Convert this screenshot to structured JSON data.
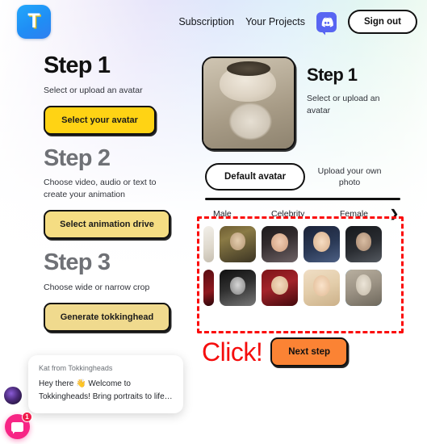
{
  "header": {
    "logo_letter": "T",
    "nav_links": [
      {
        "label": "Subscription"
      },
      {
        "label": "Your Projects"
      }
    ],
    "discord_icon": "discord-icon",
    "signout_label": "Sign out"
  },
  "left_steps": [
    {
      "title": "Step 1",
      "desc": "Select or upload an avatar",
      "button": "Select your avatar"
    },
    {
      "title": "Step 2",
      "desc": "Choose video, audio or text to create your animation",
      "button": "Select animation drive"
    },
    {
      "title": "Step 3",
      "desc": "Choose wide or narrow crop",
      "button": "Generate tokkinghead"
    }
  ],
  "preview": {
    "title": "Step 1",
    "desc": "Select or upload an avatar",
    "image_alt": "statue-avatar-thumbnail"
  },
  "tabs": {
    "default_avatar": "Default avatar",
    "upload_photo": "Upload your own photo"
  },
  "categories": [
    {
      "label": "Male"
    },
    {
      "label": "Celebrity"
    },
    {
      "label": "Female"
    }
  ],
  "category_chevron": "chevron-right-icon",
  "avatar_grid": {
    "row1": [
      {
        "name": "partial-avatar-left",
        "face": "f-light",
        "partial": true,
        "selected": false
      },
      {
        "name": "avatar-caesar-portrait",
        "face": "f-caesar",
        "partial": false,
        "selected": false
      },
      {
        "name": "avatar-dark-hair-woman",
        "face": "f-selena",
        "partial": false,
        "selected": false
      },
      {
        "name": "avatar-blonde-bob-woman",
        "face": "f-taylor1",
        "partial": false,
        "selected": false
      },
      {
        "name": "avatar-bald-man",
        "face": "f-man1",
        "partial": false,
        "selected": false
      }
    ],
    "row2": [
      {
        "name": "partial-avatar-left-2",
        "face": "f-red",
        "partial": true,
        "selected": false
      },
      {
        "name": "avatar-black-and-white-woman",
        "face": "f-bw",
        "partial": false,
        "selected": false
      },
      {
        "name": "avatar-blonde-woman-red-bg",
        "face": "f-taylor2",
        "partial": false,
        "selected": false
      },
      {
        "name": "avatar-blonde-man",
        "face": "f-justin",
        "partial": false,
        "selected": false
      },
      {
        "name": "avatar-statue-selected",
        "face": "f-statue",
        "partial": false,
        "selected": true
      }
    ]
  },
  "annotation": {
    "click_label": "Click!",
    "highlight_color": "#fb0b0b"
  },
  "next_step_button": "Next step",
  "chat": {
    "sender": "Kat from Tokkingheads",
    "message": "Hey there 👋 Welcome to Tokkingheads!  Bring portraits to life…",
    "badge_count": "1",
    "launcher_icon": "chat-bubble-icon",
    "agent_avatar": "agent-avatar"
  },
  "colors": {
    "primary_yellow": "#ffd314",
    "muted_yellow": "#f0da8e",
    "orange": "#fb8334",
    "accent_red": "#fb0b0b",
    "discord_blue": "#5865f2",
    "logo_blue": "#23a7fb",
    "chat_pink": "#f72585",
    "selection_blue": "#1b9bf0"
  }
}
